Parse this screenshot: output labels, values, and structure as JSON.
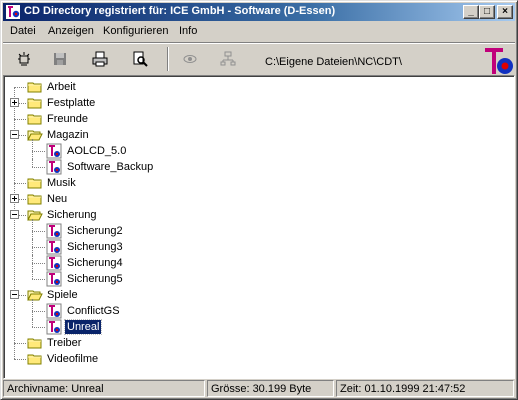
{
  "window": {
    "title": "CD Directory registriert für: ICE GmbH - Software (D-Essen)"
  },
  "titlebar_buttons": {
    "minimize": "_",
    "maximize": "□",
    "close": "×"
  },
  "menu": [
    {
      "label": "Datei"
    },
    {
      "label": "Anzeigen"
    },
    {
      "label": "Konfigurieren"
    },
    {
      "label": "Info"
    }
  ],
  "toolbar": {
    "path": "C:\\Eigene Dateien\\NC\\CDT\\",
    "icons": [
      "scan-icon",
      "save-icon",
      "print-icon",
      "search-icon",
      "view-icon",
      "network-icon"
    ]
  },
  "tree": {
    "items": [
      {
        "label": "Arbeit",
        "type": "folder"
      },
      {
        "label": "Festplatte",
        "type": "folder",
        "expander": "plus"
      },
      {
        "label": "Freunde",
        "type": "folder"
      },
      {
        "label": "Magazin",
        "type": "folder-open",
        "expander": "minus"
      },
      {
        "label": "AOLCD_5.0",
        "type": "cd"
      },
      {
        "label": "Software_Backup",
        "type": "cd"
      },
      {
        "label": "Musik",
        "type": "folder"
      },
      {
        "label": "Neu",
        "type": "folder",
        "expander": "plus"
      },
      {
        "label": "Sicherung",
        "type": "folder-open",
        "expander": "minus"
      },
      {
        "label": "Sicherung2",
        "type": "cd"
      },
      {
        "label": "Sicherung3",
        "type": "cd"
      },
      {
        "label": "Sicherung4",
        "type": "cd"
      },
      {
        "label": "Sicherung5",
        "type": "cd"
      },
      {
        "label": "Spiele",
        "type": "folder-open",
        "expander": "minus"
      },
      {
        "label": "ConflictGS",
        "type": "cd"
      },
      {
        "label": "Unreal",
        "type": "cd",
        "selected": true
      },
      {
        "label": "Treiber",
        "type": "folder"
      },
      {
        "label": "Videofilme",
        "type": "folder"
      }
    ]
  },
  "status": {
    "archive": "Archivname: Unreal",
    "size": "Grösse: 30.199 Byte",
    "time": "Zeit: 01.10.1999 21:47:52"
  },
  "colors": {
    "titlebar_start": "#0a246a",
    "titlebar_end": "#a6caf0",
    "selection": "#0a246a",
    "folder": "#ffe97a",
    "cd_icon": "#c0007a"
  }
}
